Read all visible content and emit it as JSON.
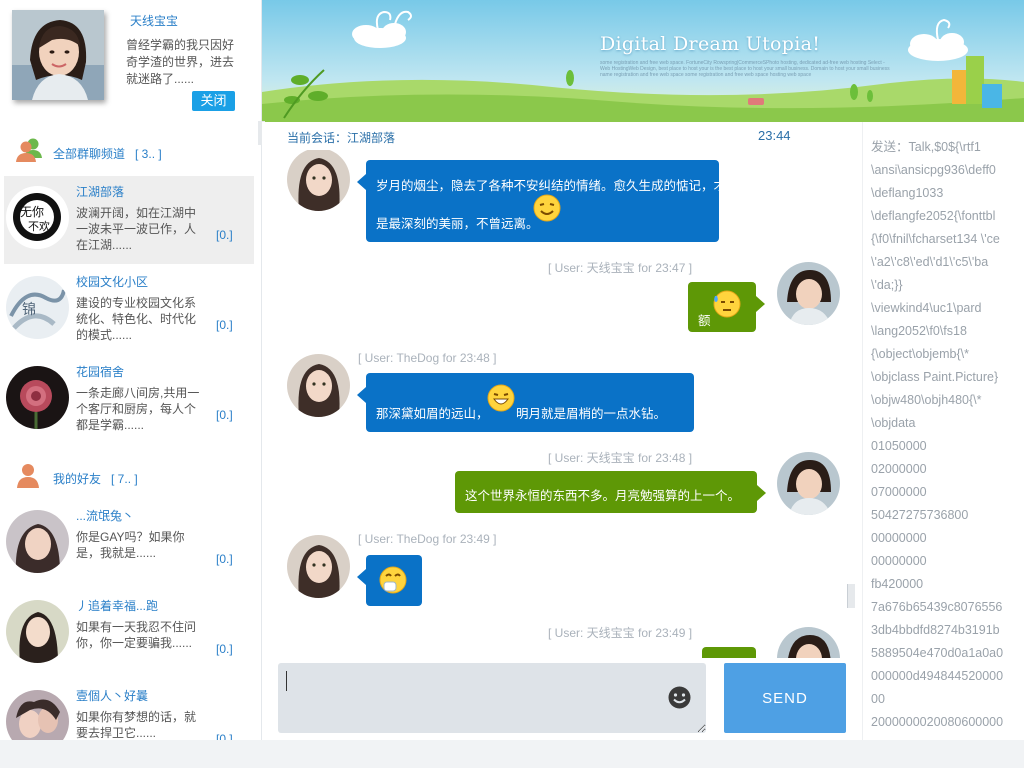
{
  "profile": {
    "name": "天线宝宝",
    "signature": "曾经学霸的我只因好奇学渣的世界，进去就迷路了......",
    "close_label": "关闭"
  },
  "groups": [
    {
      "title": "全部群聊频道",
      "count": "[ 3.. ]"
    },
    {
      "title": "我的好友",
      "count": "[ 7.. ]"
    }
  ],
  "channels": [
    {
      "name": "江湖部落",
      "message": "波澜开阔，如在江湖中一波未平一波已作，人在江湖......",
      "count": "[0.]"
    },
    {
      "name": "校园文化小区",
      "message": "建设的专业校园文化系统化、特色化、时代化的模式......",
      "count": "[0.]"
    },
    {
      "name": "花园宿舍",
      "message": "一条走廊八间房,共用一个客厅和厨房，每人个都是学霸......",
      "count": "[0.]"
    }
  ],
  "friends": [
    {
      "name": "...流氓兔丶",
      "message": "你是GAY吗？如果你是，我就是......",
      "count": "[0.]"
    },
    {
      "name": "丿追着幸福...跑",
      "message": "如果有一天我忍不住问你，你一定要骗我......",
      "count": "[0.]"
    },
    {
      "name": "壹個人丶好曩",
      "message": "如果你有梦想的话，就要去捍卫它......",
      "count": "[0.]"
    }
  ],
  "banner": {
    "title": "Digital Dream Utopia!",
    "subtitle": "some registration and free web space. FortuneCity Rowspring|CommerceSPhoto hosting, dedicated ad-free web hosting Select - Web HostingWeb Design, best place to host your is the best place to host your small business. Domain to host your small business name registration and free web space some registration and free web space hosting web space"
  },
  "session": {
    "label": "当前会话：江湖部落",
    "time": "23:44"
  },
  "messages": [
    {
      "dir": "in",
      "stamp": "",
      "line1": "岁月的烟尘，隐去了各种不安纠结的情绪。愈久生成的惦记，才",
      "line2": "是最深刻的美丽，不曾远离。"
    },
    {
      "dir": "out",
      "stamp": "[ User: 天线宝宝  for 23:47 ]",
      "text": "额"
    },
    {
      "dir": "in",
      "stamp": "[ User: TheDog for 23:48 ]",
      "text_a": "那深黛如眉的远山，",
      "text_b": "明月就是眉梢的一点水钻。"
    },
    {
      "dir": "out",
      "stamp": "[ User: 天线宝宝  for 23:48 ]",
      "text": "这个世界永恒的东西不多。月亮勉强算的上一个。"
    },
    {
      "dir": "in",
      "stamp": "[ User: TheDog for 23:49 ]",
      "text": ""
    },
    {
      "dir": "out",
      "stamp": "[ User: 天线宝宝  for 23:49 ]",
      "text": ""
    }
  ],
  "input": {
    "value": "",
    "send_label": "SEND"
  },
  "raw_panel": {
    "text": "发送：Talk,$0${\\rtf1\n\\ansi\\ansicpg936\\deff0\n\\deflang1033\n\\deflangfe2052{\\fonttbl\n{\\f0\\fnil\\fcharset134 \\'ce\n\\'a2\\'c8\\'ed\\'d1\\'c5\\'ba\n\\'da;}}\n\\viewkind4\\uc1\\pard\n\\lang2052\\f0\\fs18\n{\\object\\objemb{\\*\n\\objclass Paint.Picture}\n\\objw480\\objh480{\\*\n\\objdata\n01050000\n02000000\n07000000\n50427275736800\n00000000\n00000000\nfb420000\n7a676b65439c8076556\n3db4bbdfd8274b3191b\n5889504e470d0a1a0a0\n000000d494844520000\n00\n2000000020080600000"
  },
  "colors": {
    "accent_blue": "#0a72c7",
    "accent_green": "#5e9806",
    "link_blue": "#2a7fc8",
    "send_button": "#4ea0e4",
    "close_button": "#1aa0e6"
  }
}
